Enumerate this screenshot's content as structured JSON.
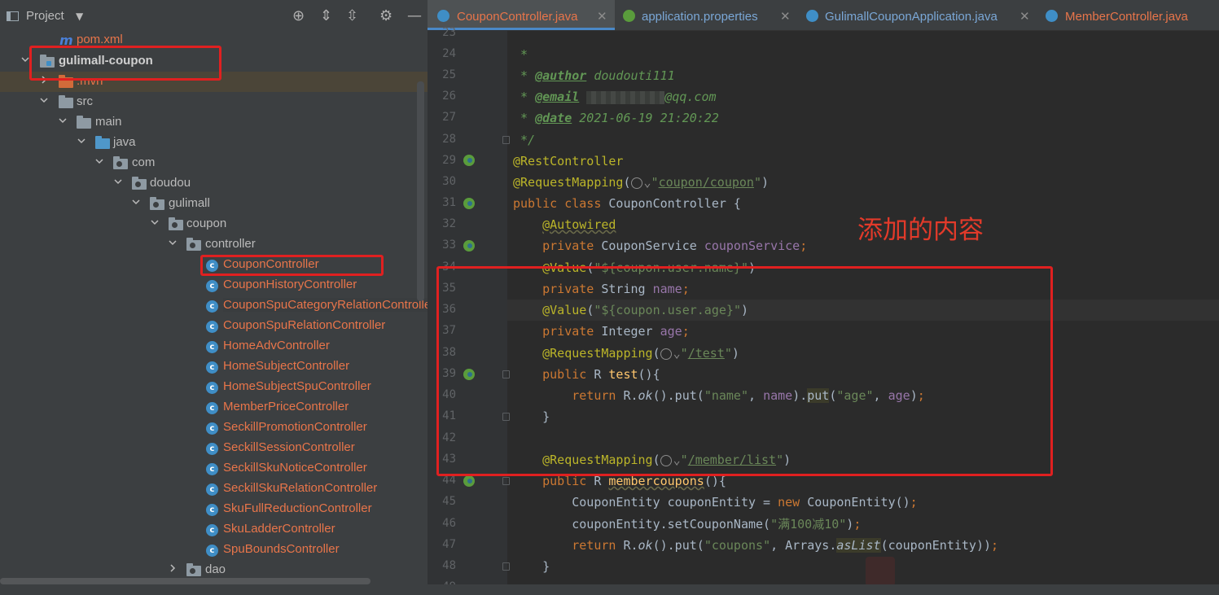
{
  "project_panel": {
    "title": "Project",
    "tree": [
      {
        "label": "pom.xml",
        "icon": "maven-icon",
        "style": "orange"
      },
      {
        "label": "gulimall-coupon",
        "icon": "module-folder-icon",
        "style": "bold"
      },
      {
        "label": ".mvn",
        "icon": "folder-icon",
        "style": "orange"
      },
      {
        "label": "src",
        "icon": "folder-icon",
        "style": "normal"
      },
      {
        "label": "main",
        "icon": "folder-icon",
        "style": "normal"
      },
      {
        "label": "java",
        "icon": "source-folder-icon",
        "style": "normal"
      },
      {
        "label": "com",
        "icon": "package-icon",
        "style": "normal"
      },
      {
        "label": "doudou",
        "icon": "package-icon",
        "style": "normal"
      },
      {
        "label": "gulimall",
        "icon": "package-icon",
        "style": "normal"
      },
      {
        "label": "coupon",
        "icon": "package-icon",
        "style": "normal"
      },
      {
        "label": "controller",
        "icon": "package-icon",
        "style": "normal"
      },
      {
        "label": "CouponController",
        "icon": "class-icon",
        "style": "orange"
      },
      {
        "label": "CouponHistoryController",
        "icon": "class-icon",
        "style": "orange"
      },
      {
        "label": "CouponSpuCategoryRelationController",
        "icon": "class-icon",
        "style": "orange"
      },
      {
        "label": "CouponSpuRelationController",
        "icon": "class-icon",
        "style": "orange"
      },
      {
        "label": "HomeAdvController",
        "icon": "class-icon",
        "style": "orange"
      },
      {
        "label": "HomeSubjectController",
        "icon": "class-icon",
        "style": "orange"
      },
      {
        "label": "HomeSubjectSpuController",
        "icon": "class-icon",
        "style": "orange"
      },
      {
        "label": "MemberPriceController",
        "icon": "class-icon",
        "style": "orange"
      },
      {
        "label": "SeckillPromotionController",
        "icon": "class-icon",
        "style": "orange"
      },
      {
        "label": "SeckillSessionController",
        "icon": "class-icon",
        "style": "orange"
      },
      {
        "label": "SeckillSkuNoticeController",
        "icon": "class-icon",
        "style": "orange"
      },
      {
        "label": "SeckillSkuRelationController",
        "icon": "class-icon",
        "style": "orange"
      },
      {
        "label": "SkuFullReductionController",
        "icon": "class-icon",
        "style": "orange"
      },
      {
        "label": "SkuLadderController",
        "icon": "class-icon",
        "style": "orange"
      },
      {
        "label": "SpuBoundsController",
        "icon": "class-icon",
        "style": "orange"
      },
      {
        "label": "dao",
        "icon": "package-icon",
        "style": "normal"
      }
    ]
  },
  "tabs": [
    {
      "label": "CouponController.java",
      "active": true
    },
    {
      "label": "application.properties",
      "active": false
    },
    {
      "label": "GulimallCouponApplication.java",
      "active": false
    },
    {
      "label": "MemberController.java",
      "active": false
    }
  ],
  "code": {
    "line_numbers": [
      "23",
      "24",
      "25",
      "26",
      "27",
      "28",
      "29",
      "30",
      "31",
      "32",
      "33",
      "34",
      "35",
      "36",
      "37",
      "38",
      "39",
      "40",
      "41",
      "42",
      "43",
      "44",
      "45",
      "46",
      "47",
      "48",
      "49"
    ],
    "author_tag": "@author",
    "author": "doudouti111",
    "email_tag": "@email",
    "email_suffix": "@qq.com",
    "date_tag": "@date",
    "date": "2021-06-19 21:20:22",
    "rest_controller": "@RestController",
    "request_mapping": "@RequestMapping",
    "class_mapping": "coupon/coupon",
    "class_decl_kw": "public class",
    "class_name": "CouponController {",
    "autowired": "@Autowired",
    "service_type": "CouponService",
    "service_field": "couponService",
    "value_ann": "@Value",
    "name_expr": "${coupon.user.name}",
    "age_expr": "${coupon.user.age}",
    "name_field": "name",
    "age_field": "age",
    "test_mapping": "/test",
    "test_method": "test",
    "member_mapping": "/member/list",
    "member_method": "membercoupons",
    "coupon_name_value": "满100减10",
    "coupons_key": "coupons"
  },
  "annotation_note": "添加的内容"
}
